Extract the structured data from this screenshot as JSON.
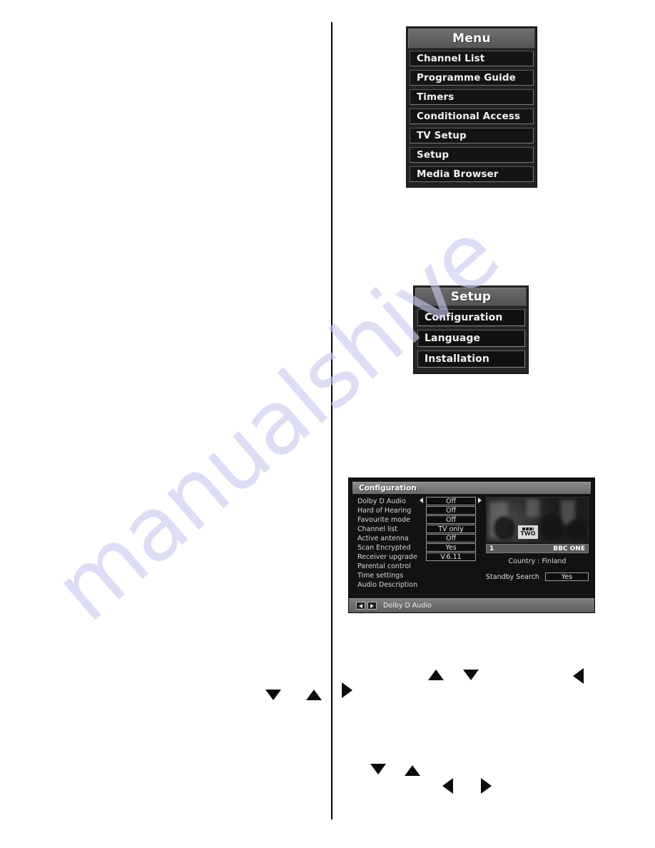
{
  "page": {
    "watermark_text": "manualshive"
  },
  "menu_panel": {
    "title": "Menu",
    "items": [
      {
        "label": "Channel List"
      },
      {
        "label": "Programme Guide"
      },
      {
        "label": "Timers"
      },
      {
        "label": "Conditional Access"
      },
      {
        "label": "TV Setup"
      },
      {
        "label": "Setup"
      },
      {
        "label": "Media Browser"
      }
    ]
  },
  "setup_panel": {
    "title": "Setup",
    "items": [
      {
        "label": "Configuration"
      },
      {
        "label": "Language"
      },
      {
        "label": "Installation"
      }
    ]
  },
  "configuration_panel": {
    "title": "Configuration",
    "settings": [
      {
        "label": "Dolby D Audio",
        "value": "Off",
        "selected": true
      },
      {
        "label": "Hard of Hearing",
        "value": "Off",
        "selected": false
      },
      {
        "label": "Favourite mode",
        "value": "Off",
        "selected": false
      },
      {
        "label": "Channel list",
        "value": "TV only",
        "selected": false
      },
      {
        "label": "Active antenna",
        "value": "Off",
        "selected": false
      },
      {
        "label": "Scan Encrypted",
        "value": "Yes",
        "selected": false
      },
      {
        "label": "Receiver upgrade",
        "value": "V.6.11",
        "selected": false
      },
      {
        "label": "Parental control",
        "value": "",
        "selected": false
      },
      {
        "label": "Time settings",
        "value": "",
        "selected": false
      },
      {
        "label": "Audio Description",
        "value": "",
        "selected": false
      }
    ],
    "preview": {
      "channel_logo": "TWO",
      "channel_number": "1",
      "channel_name": "BBC ONE"
    },
    "country_line": "Country : Finland",
    "standby_search": {
      "label": "Standby Search",
      "value": "Yes"
    },
    "footer": {
      "left_key_icon": "left-arrow-icon",
      "right_key_icon": "right-arrow-icon",
      "hint": "Dolby D Audio"
    }
  },
  "inline_arrows": [
    {
      "name": "arrow-down-left-col",
      "direction": "down"
    },
    {
      "name": "arrow-up-left-col",
      "direction": "up"
    },
    {
      "name": "arrow-right-rc-1",
      "direction": "right"
    },
    {
      "name": "arrow-up-rc-1",
      "direction": "up"
    },
    {
      "name": "arrow-down-rc-1",
      "direction": "down"
    },
    {
      "name": "arrow-left-rc-1",
      "direction": "left"
    },
    {
      "name": "arrow-down-rc-2",
      "direction": "down"
    },
    {
      "name": "arrow-up-rc-2",
      "direction": "up"
    },
    {
      "name": "arrow-left-rc-2",
      "direction": "left"
    },
    {
      "name": "arrow-right-rc-2",
      "direction": "right"
    }
  ]
}
